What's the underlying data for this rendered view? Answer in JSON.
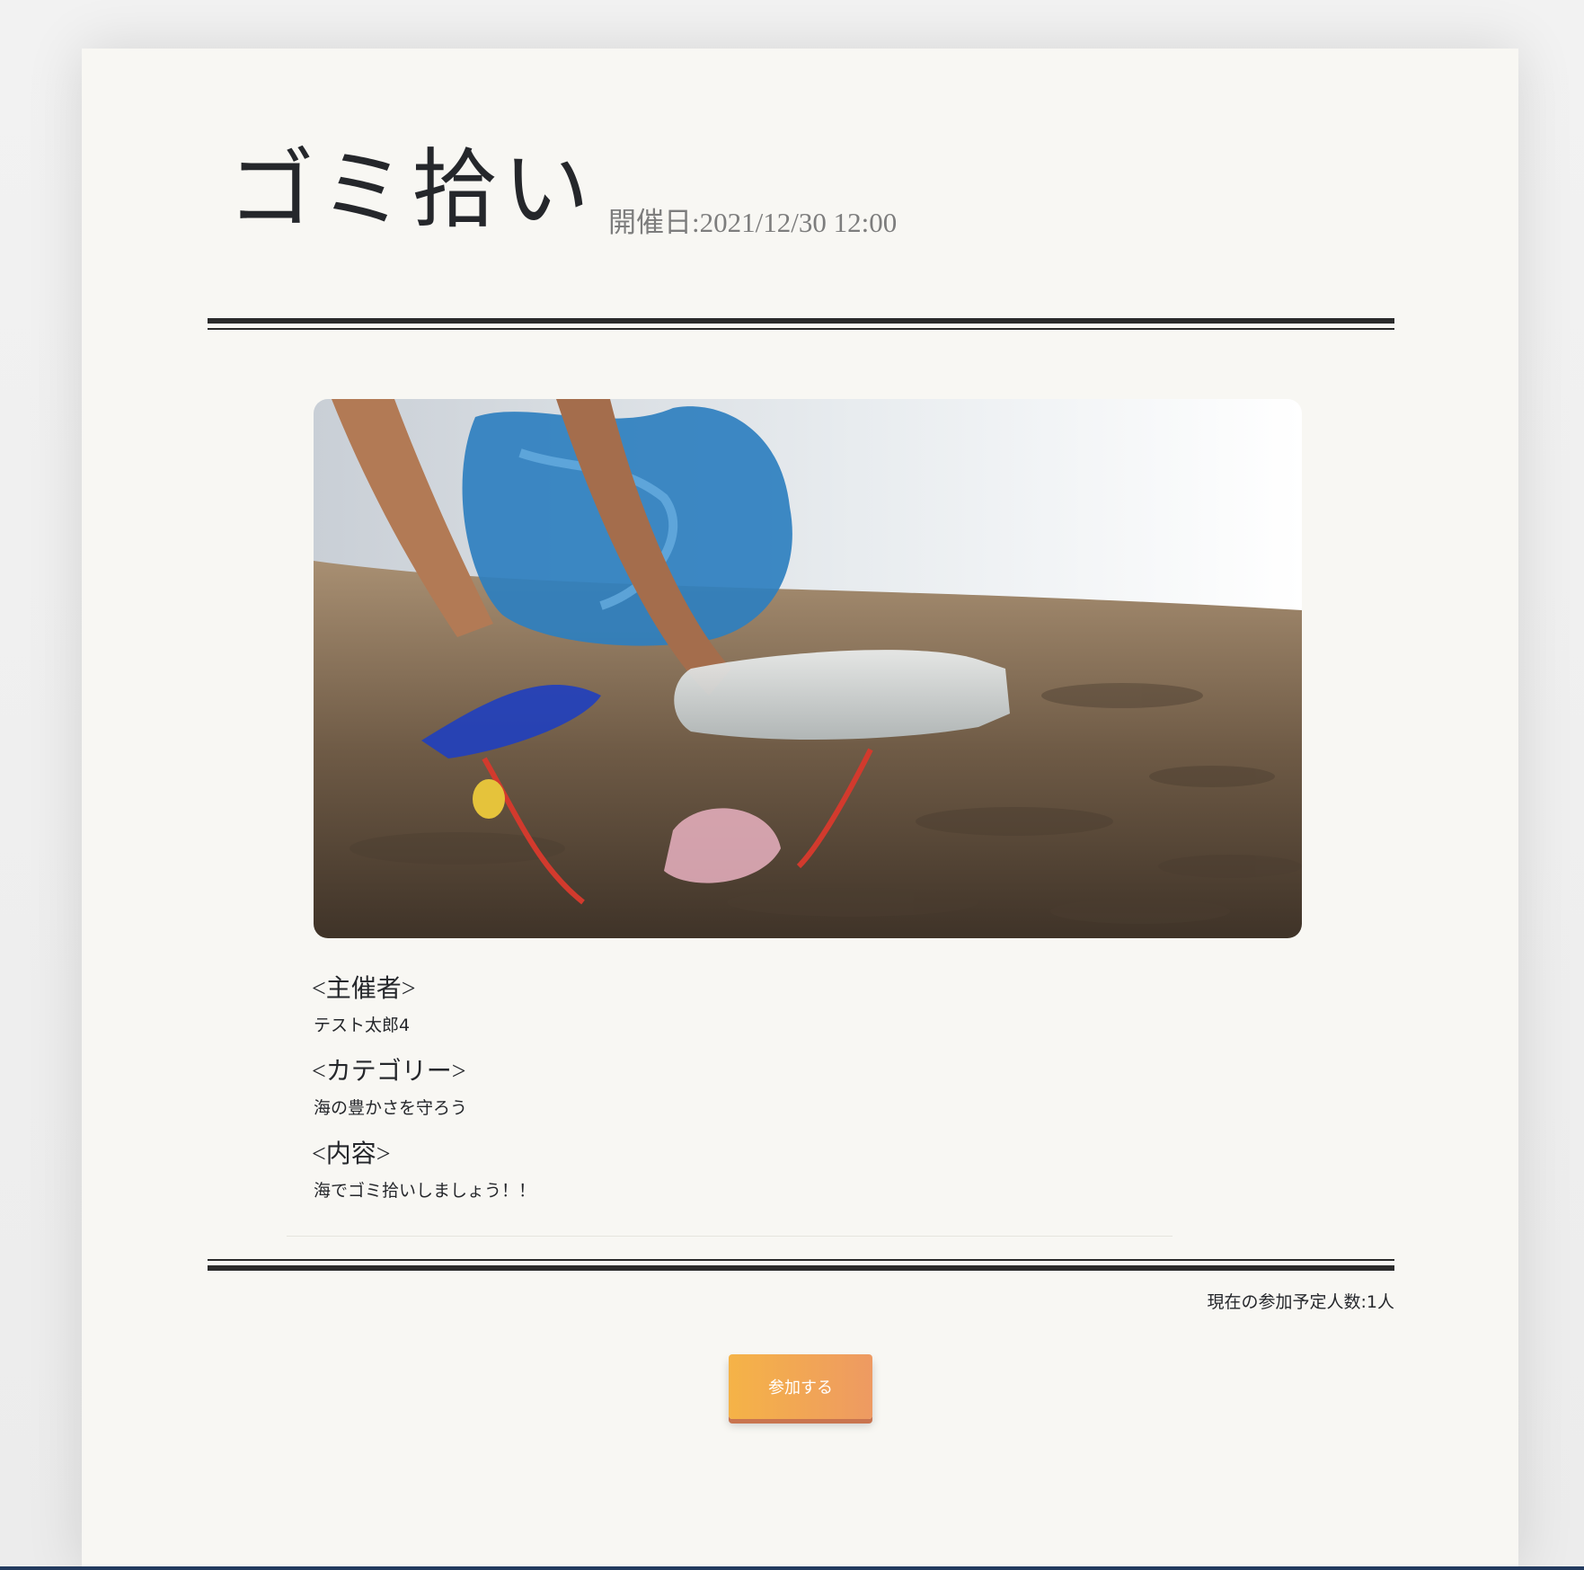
{
  "event": {
    "title": "ゴミ拾い",
    "date_label": "開催日:2021/12/30 12:00"
  },
  "photo": {
    "alt": "Beach garbage cleanup photo"
  },
  "details": {
    "organizer_heading": "<主催者>",
    "organizer_value": "テスト太郎4",
    "category_heading": "<カテゴリー>",
    "category_value": "海の豊かさを守ろう",
    "content_heading": "<内容>",
    "content_value": "海でゴミ拾いしましょう！！"
  },
  "participation": {
    "count_label": "現在の参加予定人数:1人",
    "join_label": "参加する"
  },
  "colors": {
    "card_background": "#f8f7f3",
    "text": "#25272b",
    "date_text": "#7d7d7d",
    "button_gradient_start": "#f5b347",
    "button_gradient_end": "#ee9a62"
  }
}
